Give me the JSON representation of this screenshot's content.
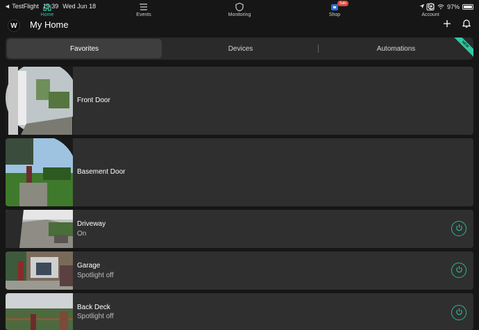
{
  "status_bar": {
    "back_app": "◄ TestFlight",
    "time": "19:39",
    "date": "Wed Jun 18",
    "battery": "97%",
    "battery_level": 0.97
  },
  "tab_bar": [
    {
      "label": "Home",
      "icon": "home-icon",
      "active": true
    },
    {
      "label": "Events",
      "icon": "list-icon",
      "active": false
    },
    {
      "label": "Monitoring",
      "icon": "shield-icon",
      "active": false
    },
    {
      "label": "Shop",
      "icon": "shop-icon",
      "active": false,
      "badge": "Sale"
    },
    {
      "label": "Account",
      "icon": "account-icon",
      "active": false
    }
  ],
  "header": {
    "logo": "W",
    "title": "My Home"
  },
  "segments": [
    {
      "label": "Favorites",
      "active": true
    },
    {
      "label": "Devices",
      "active": false
    },
    {
      "label": "Automations",
      "active": false,
      "badge": "NEW"
    }
  ],
  "devices": [
    {
      "name": "Front Door",
      "status": ""
    },
    {
      "name": "Basement Door",
      "status": ""
    },
    {
      "name": "Driveway",
      "status": "On"
    },
    {
      "name": "Garage",
      "status": "Spotlight off"
    },
    {
      "name": "Back Deck",
      "status": "Spotlight off"
    }
  ],
  "colors": {
    "accent": "#34c6a0",
    "card_bg": "#2f2f2f",
    "page_bg": "#161616",
    "sale": "#e2463a"
  }
}
